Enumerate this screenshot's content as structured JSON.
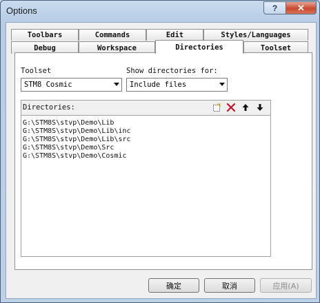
{
  "window": {
    "title": "Options",
    "help_label": "?",
    "close_label": "✕"
  },
  "tabs_row1": [
    {
      "label": "Toolbars"
    },
    {
      "label": "Commands"
    },
    {
      "label": "Edit"
    },
    {
      "label": "Styles/Languages"
    }
  ],
  "tabs_row2": [
    {
      "label": "Debug"
    },
    {
      "label": "Workspace"
    },
    {
      "label": "Directories"
    },
    {
      "label": "Toolset"
    }
  ],
  "active_tab": "Directories",
  "toolset": {
    "label": "Toolset",
    "value": "STM8 Cosmic"
  },
  "show_dirs": {
    "label": "Show directories for:",
    "value": "Include files"
  },
  "directories": {
    "label": "Directories:",
    "items": [
      "G:\\STM8S\\stvp\\Demo\\Lib",
      "G:\\STM8S\\stvp\\Demo\\Lib\\inc",
      "G:\\STM8S\\stvp\\Demo\\Lib\\src",
      "G:\\STM8S\\stvp\\Demo\\Src",
      "G:\\STM8S\\stvp\\Demo\\Cosmic"
    ]
  },
  "buttons": {
    "ok": "确定",
    "cancel": "取消",
    "apply": "应用(A)"
  }
}
